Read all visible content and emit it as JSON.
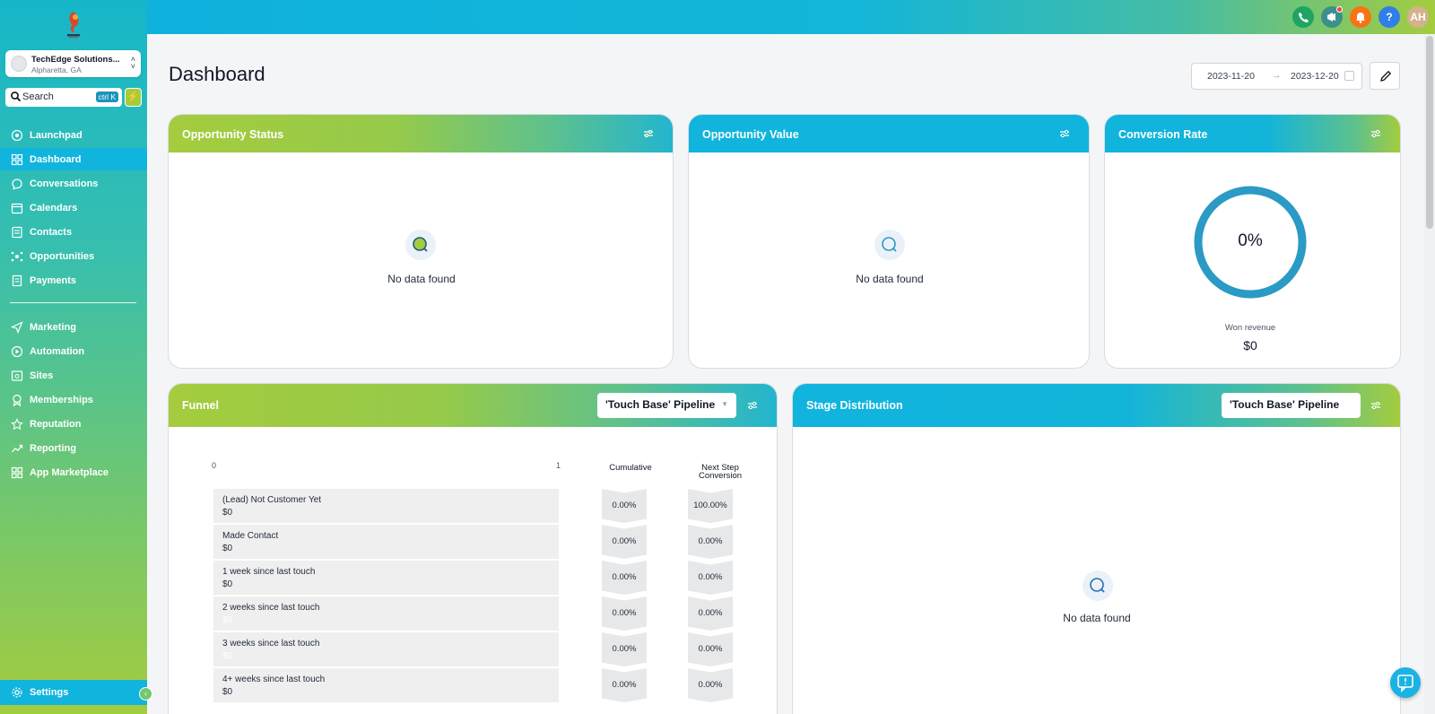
{
  "sidebar": {
    "account": {
      "name": "TechEdge Solutions...",
      "location": "Alpharetta, GA"
    },
    "search": {
      "label": "Search",
      "shortcut": "ctrl K"
    },
    "items": [
      {
        "label": "Launchpad",
        "icon": "launchpad-icon"
      },
      {
        "label": "Dashboard",
        "icon": "grid-icon",
        "active": true
      },
      {
        "label": "Conversations",
        "icon": "chat-icon"
      },
      {
        "label": "Calendars",
        "icon": "calendar-icon"
      },
      {
        "label": "Contacts",
        "icon": "contacts-icon"
      },
      {
        "label": "Opportunities",
        "icon": "opportunities-icon"
      },
      {
        "label": "Payments",
        "icon": "payments-icon"
      },
      {
        "label": "Marketing",
        "icon": "send-icon"
      },
      {
        "label": "Automation",
        "icon": "automation-icon"
      },
      {
        "label": "Sites",
        "icon": "sites-icon"
      },
      {
        "label": "Memberships",
        "icon": "badge-icon"
      },
      {
        "label": "Reputation",
        "icon": "star-icon"
      },
      {
        "label": "Reporting",
        "icon": "trend-icon"
      },
      {
        "label": "App Marketplace",
        "icon": "apps-icon"
      }
    ],
    "settings_label": "Settings"
  },
  "topbar": {
    "avatar_initials": "AH",
    "help": "?"
  },
  "main": {
    "title": "Dashboard",
    "date_from": "2023-11-20",
    "date_to": "2023-12-20",
    "date_arrow": "→"
  },
  "opportunity_status": {
    "title": "Opportunity Status",
    "empty": "No data found"
  },
  "opportunity_value": {
    "title": "Opportunity Value",
    "empty": "No data found"
  },
  "conversion_rate": {
    "title": "Conversion Rate",
    "percent": "0%",
    "won_label": "Won revenue",
    "won_value": "$0",
    "rate_value": 0
  },
  "funnel": {
    "title": "Funnel",
    "pipeline": "'Touch Base' Pipeline",
    "axis_min": "0",
    "axis_max": "1",
    "col_cumulative": "Cumulative",
    "col_next_line1": "Next Step",
    "col_next_line2": "Conversion",
    "rows": [
      {
        "label": "(Lead) Not Customer Yet",
        "value": "$0",
        "cumulative": "0.00%",
        "next": "100.00%"
      },
      {
        "label": "Made Contact",
        "value": "$0",
        "cumulative": "0.00%",
        "next": "0.00%"
      },
      {
        "label": "1 week since last touch",
        "value": "$0",
        "cumulative": "0.00%",
        "next": "0.00%"
      },
      {
        "label": "2 weeks since last touch",
        "value": "$0",
        "cumulative": "0.00%",
        "next": "0.00%"
      },
      {
        "label": "3 weeks since last touch",
        "value": "$0",
        "cumulative": "0.00%",
        "next": "0.00%"
      },
      {
        "label": "4+ weeks since last touch",
        "value": "$0",
        "cumulative": "0.00%",
        "next": "0.00%"
      }
    ]
  },
  "stage_distribution": {
    "title": "Stage Distribution",
    "pipeline": "'Touch Base' Pipeline",
    "empty": "No data found"
  },
  "colors": {
    "teal": "#10b4dd",
    "lime": "#a4cc3e",
    "donut": "#2b9ac4"
  }
}
